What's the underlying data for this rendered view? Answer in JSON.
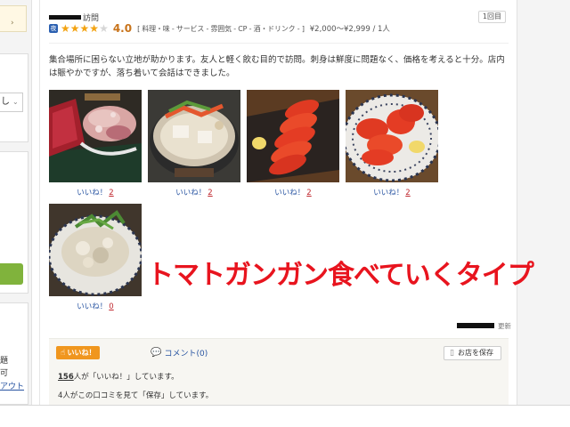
{
  "sidebar": {
    "select_value": "し",
    "links": [
      "題",
      "可",
      "アウト"
    ]
  },
  "review": {
    "visit_label": "訪問",
    "visit_count": "1回目",
    "category_badge": "夜",
    "rating": 4.0,
    "score": "4.0",
    "sub_ratings": "[ 料理・味 -   サービス -   雰囲気 -   CP -   酒・ドリンク - ]",
    "price": "¥2,000～¥2,999 / 1人",
    "text": "集合場所に困らない立地が助かります。友人と軽く飲む目的で訪問。刺身は鮮度に問題なく、価格を考えると十分。店内は賑やかですが、落ち着いて会話はできました。",
    "photos": [
      {
        "name": "sashimi-tako",
        "like_label": "いいね！",
        "likes": "2"
      },
      {
        "name": "hotpot",
        "like_label": "いいね！",
        "likes": "2"
      },
      {
        "name": "tomato-1",
        "like_label": "いいね！",
        "likes": "2"
      },
      {
        "name": "tomato-2",
        "like_label": "いいね！",
        "likes": "2"
      },
      {
        "name": "potato-salad",
        "like_label": "いいね！",
        "likes": "0"
      }
    ],
    "overlay_caption": "トマトガンガン食べていくタイプ",
    "update_label": "更新"
  },
  "actions": {
    "like_button": "いいね！",
    "comment_label": "コメント(0)",
    "save_button": "お店を保存",
    "likes_count": "156",
    "likes_suffix": "人が「いいね！」しています。",
    "saves_text": "4人がこの口コミを見て「保存」しています。"
  },
  "colors": {
    "star": "#f3a312",
    "score": "#c8731a",
    "link": "#2955a2",
    "like_count": "#c0282f",
    "like_button": "#f0961e",
    "overlay_caption": "#e8141e",
    "sidebar_green": "#80b33c"
  },
  "icons": {
    "category": "category-badge-icon",
    "like": "thumbs-up-icon",
    "comment": "speech-bubble-icon",
    "save": "bookmark-icon"
  }
}
